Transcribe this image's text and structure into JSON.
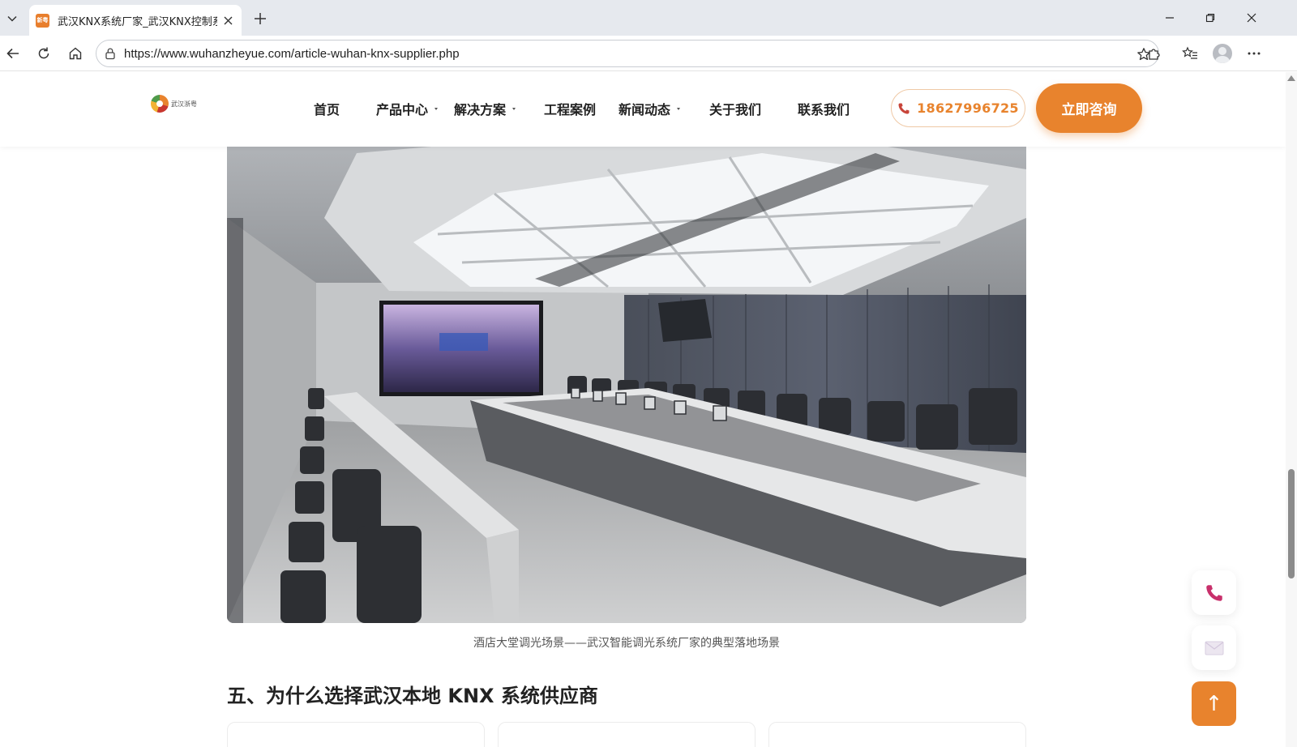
{
  "browser": {
    "tab_title": "武汉KNX系统厂家_武汉KNX控制系",
    "favicon_text": "新粤",
    "url": "https://www.wuhanzheyue.com/article-wuhan-knx-supplier.php"
  },
  "site": {
    "logo_text": "武汉浙粤",
    "nav": [
      {
        "label": "首页",
        "dropdown": false
      },
      {
        "label": "产品中心",
        "dropdown": true
      },
      {
        "label": "解决方案",
        "dropdown": true
      },
      {
        "label": "工程案例",
        "dropdown": false
      },
      {
        "label": "新闻动态",
        "dropdown": true
      },
      {
        "label": "关于我们",
        "dropdown": false
      },
      {
        "label": "联系我们",
        "dropdown": false
      }
    ],
    "phone": "18627996725",
    "consult_label": "立即咨询",
    "accent_color": "#e8832d"
  },
  "article": {
    "image_caption": "酒店大堂调光场景——武汉智能调光系统厂家的典型落地场景",
    "section_heading": "五、为什么选择武汉本地 KNX 系统供应商"
  },
  "floating": {
    "top_label": "↑"
  }
}
